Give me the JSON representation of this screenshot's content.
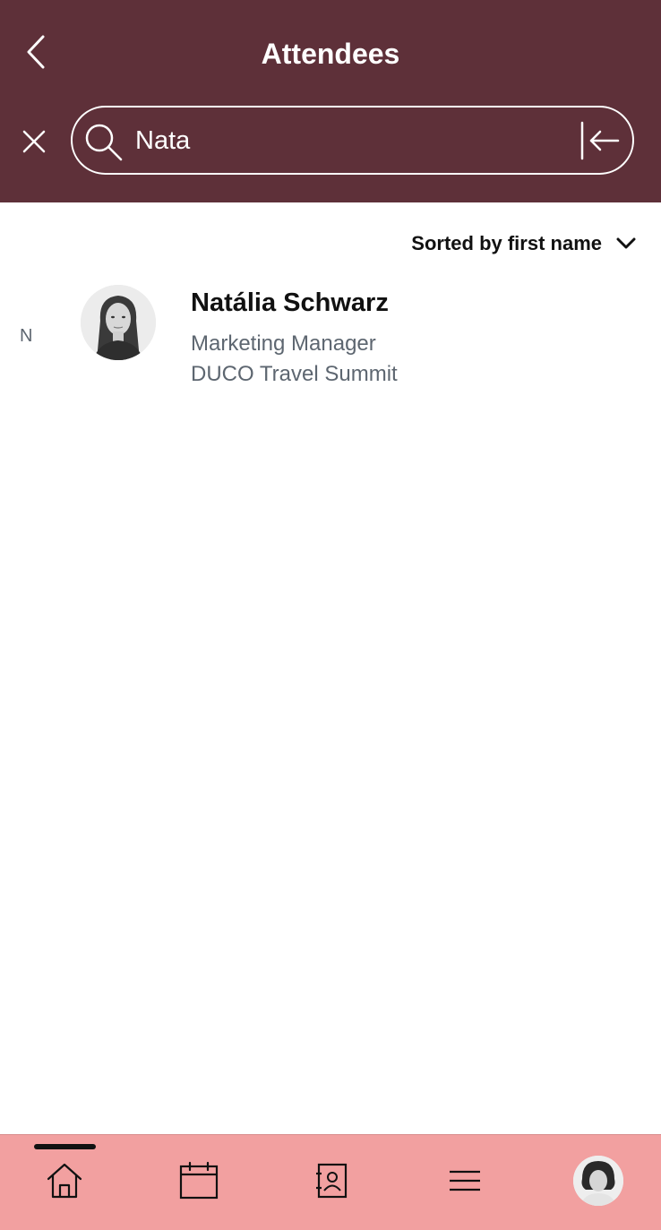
{
  "header": {
    "title": "Attendees",
    "back_icon": "chevron-left-icon",
    "background_color": "#5e3039"
  },
  "search": {
    "value": "Nata",
    "clear_icon": "close-icon",
    "search_icon": "search-icon",
    "submit_icon": "arrow-left-to-bar-icon"
  },
  "sort": {
    "label": "Sorted by first name",
    "icon": "chevron-down-icon"
  },
  "list": {
    "sections": [
      {
        "letter": "N",
        "items": [
          {
            "name": "Natália Schwarz",
            "role": "Marketing Manager",
            "event": "DUCO Travel Summit",
            "avatar": "avatar-photo"
          }
        ]
      }
    ]
  },
  "tabbar": {
    "background_color": "#f2a0a0",
    "tabs": [
      {
        "icon": "home-icon",
        "active": true
      },
      {
        "icon": "calendar-icon",
        "active": false
      },
      {
        "icon": "contacts-icon",
        "active": false
      },
      {
        "icon": "menu-icon",
        "active": false
      },
      {
        "icon": "profile-avatar",
        "active": false
      }
    ]
  }
}
